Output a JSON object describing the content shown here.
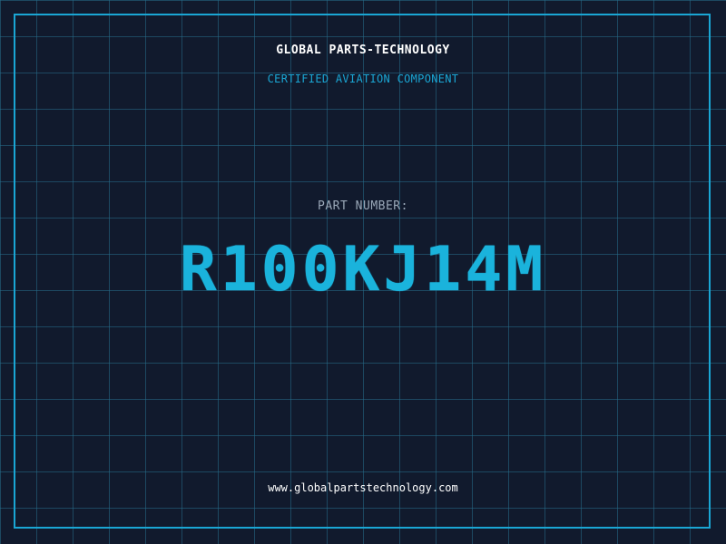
{
  "header": {
    "company": "GLOBAL PARTS-TECHNOLOGY",
    "subtitle": "CERTIFIED AVIATION COMPONENT"
  },
  "part": {
    "label": "PART NUMBER:",
    "number": "R100KJ14M"
  },
  "footer": {
    "website": "www.globalpartstechnology.com"
  },
  "colors": {
    "background": "#111a2d",
    "grid": "#266e8c",
    "accent": "#1aa6d4",
    "text": "#ffffff",
    "muted": "#9aa8b8"
  }
}
